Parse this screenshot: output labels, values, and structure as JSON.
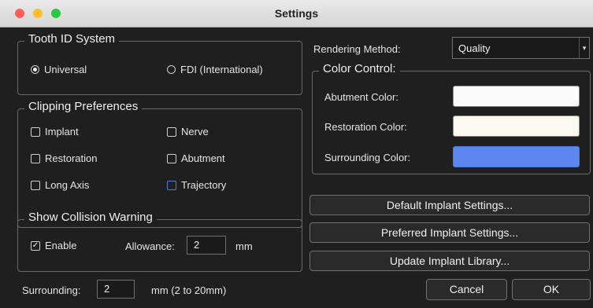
{
  "window": {
    "title": "Settings"
  },
  "colors": {
    "close": "#ff5f57",
    "minimize": "#febc2e",
    "zoom": "#28c840",
    "abutment": "#fbfbfb",
    "restoration": "#fbf9f0",
    "surrounding": "#5d87ef"
  },
  "tooth_id": {
    "legend": "Tooth ID System",
    "options": [
      {
        "label": "Universal",
        "selected": true
      },
      {
        "label": "FDI (International)",
        "selected": false
      }
    ]
  },
  "clipping": {
    "legend": "Clipping Preferences",
    "items": [
      {
        "label": "Implant",
        "checked": false
      },
      {
        "label": "Nerve",
        "checked": false
      },
      {
        "label": "Restoration",
        "checked": false
      },
      {
        "label": "Abutment",
        "checked": false
      },
      {
        "label": "Long Axis",
        "checked": false
      },
      {
        "label": "Trajectory",
        "checked": false
      }
    ]
  },
  "collision": {
    "legend": "Show Collision Warning",
    "enable_label": "Enable",
    "enable_checked": true,
    "allowance_label": "Allowance:",
    "allowance_value": "2",
    "unit": "mm"
  },
  "surrounding": {
    "label": "Surrounding:",
    "value": "2",
    "hint": "mm (2 to 20mm)"
  },
  "rendering": {
    "label": "Rendering Method:",
    "value": "Quality"
  },
  "color_control": {
    "legend": "Color Control:",
    "abutment_label": "Abutment Color:",
    "restoration_label": "Restoration Color:",
    "surrounding_label": "Surrounding Color:"
  },
  "buttons": {
    "default_implant": "Default Implant Settings...",
    "preferred_implant": "Preferred Implant Settings...",
    "update_library": "Update Implant Library...",
    "cancel": "Cancel",
    "ok": "OK"
  }
}
